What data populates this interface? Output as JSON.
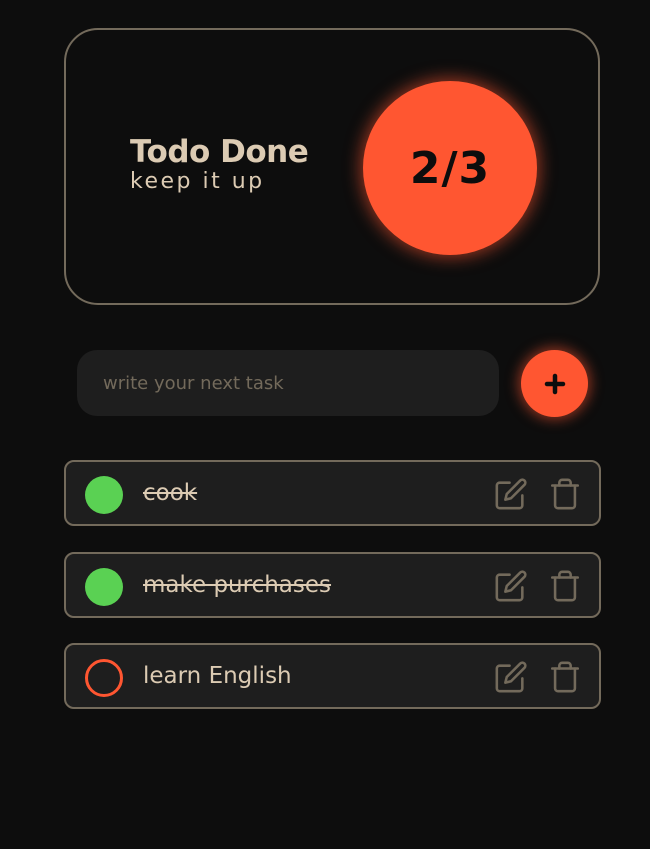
{
  "stats": {
    "title": "Todo Done",
    "subtitle": "keep it up",
    "count": "2/3",
    "completed": 2,
    "total": 3
  },
  "form": {
    "input_value": "",
    "placeholder": "write your next task",
    "add_icon": "plus-icon"
  },
  "todos": [
    {
      "text": "cook",
      "done": true
    },
    {
      "text": "make purchases",
      "done": true
    },
    {
      "text": "learn English",
      "done": false
    }
  ],
  "icons": {
    "edit": "edit-icon",
    "delete": "trash-icon"
  },
  "colors": {
    "background": "#0d0d0d",
    "accent": "#ff5631",
    "done": "#5ad153",
    "text": "#dccbb3",
    "border": "#736a5b",
    "item_background": "#1e1e1e"
  }
}
